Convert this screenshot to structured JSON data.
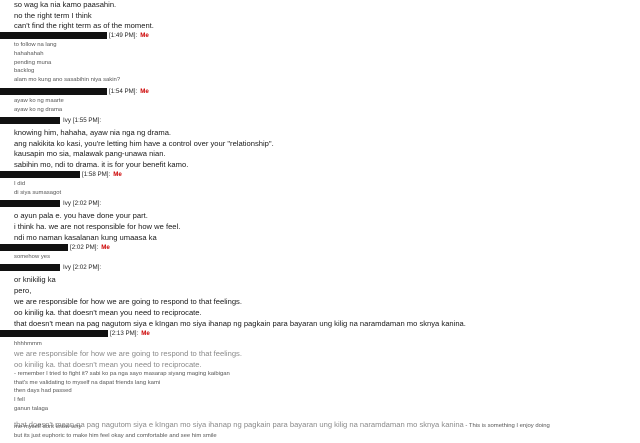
{
  "messages": [
    {
      "kind": "text",
      "style": "big",
      "text": "so wag ka nia kamo paasahin."
    },
    {
      "kind": "text",
      "style": "big",
      "text": "no the right term I think"
    },
    {
      "kind": "text",
      "style": "big",
      "text": "can't find the right term as of the moment."
    },
    {
      "kind": "header",
      "time": "[1:49 PM]:",
      "sender": "Me"
    },
    {
      "kind": "text",
      "style": "small",
      "text": "to follow na lang"
    },
    {
      "kind": "text",
      "style": "small",
      "text": "hahahahah"
    },
    {
      "kind": "text",
      "style": "small",
      "text": "pending muna"
    },
    {
      "kind": "text",
      "style": "small",
      "text": "backlog"
    },
    {
      "kind": "text",
      "style": "small",
      "text": "alam mo kung ano sasabihin niya sakin?"
    },
    {
      "kind": "header",
      "time": "[1:54 PM]:",
      "sender": "Me"
    },
    {
      "kind": "text",
      "style": "small",
      "text": "ayaw ko ng maarte"
    },
    {
      "kind": "text",
      "style": "small",
      "text": "ayaw ko ng drama"
    },
    {
      "kind": "header",
      "time": "[1:55 PM]:",
      "sender": "Ivy"
    },
    {
      "kind": "text",
      "style": "big",
      "text": "knowing him, hahaha, ayaw nia nga ng drama."
    },
    {
      "kind": "text",
      "style": "big",
      "text": "ang nakikita ko kasi, you're letting him have a control over your \"relationship\"."
    },
    {
      "kind": "text",
      "style": "big",
      "text": "kausapin mo sia, malawak pang-unawa nian."
    },
    {
      "kind": "text",
      "style": "big",
      "text": "sabihin mo, ndi to drama. it is for your benefit kamo."
    },
    {
      "kind": "header",
      "time": "[1:58 PM]:",
      "sender": "Me"
    },
    {
      "kind": "text",
      "style": "small",
      "text": "I did"
    },
    {
      "kind": "text",
      "style": "small",
      "text": "di siya sumasagot"
    },
    {
      "kind": "header",
      "time": "[2:02 PM]:",
      "sender": "Ivy"
    },
    {
      "kind": "text",
      "style": "big",
      "text": "o ayun pala e. you have done your part."
    },
    {
      "kind": "text",
      "style": "big",
      "text": "i think ha. we are not responsible for how we feel."
    },
    {
      "kind": "text",
      "style": "big",
      "text": "ndi mo naman kasalanan kung umaasa ka"
    },
    {
      "kind": "header",
      "time": "[2:02 PM]:",
      "sender": "Me"
    },
    {
      "kind": "text",
      "style": "small",
      "text": "somehow yes"
    },
    {
      "kind": "header",
      "time": "[2:02 PM]:",
      "sender": "Ivy"
    },
    {
      "kind": "text",
      "style": "big",
      "text": "or knikilig ka"
    },
    {
      "kind": "text",
      "style": "big",
      "text": "pero,"
    },
    {
      "kind": "text",
      "style": "big",
      "text": "we are responsible for how we are going to respond to that feelings."
    },
    {
      "kind": "text",
      "style": "big",
      "text": "oo kinilig ka. that doesn't mean you need to reciprocate."
    },
    {
      "kind": "text",
      "style": "big",
      "text": "that doesn't mean na pag nagutom siya e kIngan mo siya ihanap ng pagkain para bayaran ung kilig na naramdaman mo sknya kanina."
    },
    {
      "kind": "header",
      "time": "[2:13 PM]:",
      "sender": "Me"
    },
    {
      "kind": "text",
      "style": "small",
      "text": "hhhhmmm"
    },
    {
      "kind": "text",
      "style": "faint",
      "text": "we are responsible for how we are going to respond to that feelings."
    },
    {
      "kind": "text",
      "style": "faint",
      "text": "oo kinilig ka. that doesn't mean you need to reciprocate."
    },
    {
      "kind": "text",
      "style": "small",
      "text": "- remember I tried to fight it? sabi ko pa nga sayo masarap siyang maging kaibigan"
    },
    {
      "kind": "text",
      "style": "small",
      "text": "that's me validating to myself na dapat friends lang kami"
    },
    {
      "kind": "text",
      "style": "small",
      "text": "then days had passed"
    },
    {
      "kind": "text",
      "style": "small",
      "text": "I fell"
    },
    {
      "kind": "text",
      "style": "small",
      "text": "ganun talaga"
    },
    {
      "kind": "mixed",
      "faint": "that doesn't mean na pag nagutom siya e kIngan mo siya ihanap ng pagkain para bayaran ung kilig na naramdaman mo sknya kanina",
      "small": " - This is something I enjoy doing"
    },
    {
      "kind": "text",
      "style": "small",
      "text": "me myself dont know why"
    },
    {
      "kind": "text",
      "style": "small",
      "text": "but its just euphoric to make him feel okay and comfortable and see him smile"
    }
  ],
  "layout_hint": {
    "redaction_color": "#111111",
    "me_color": "#cc0000"
  }
}
